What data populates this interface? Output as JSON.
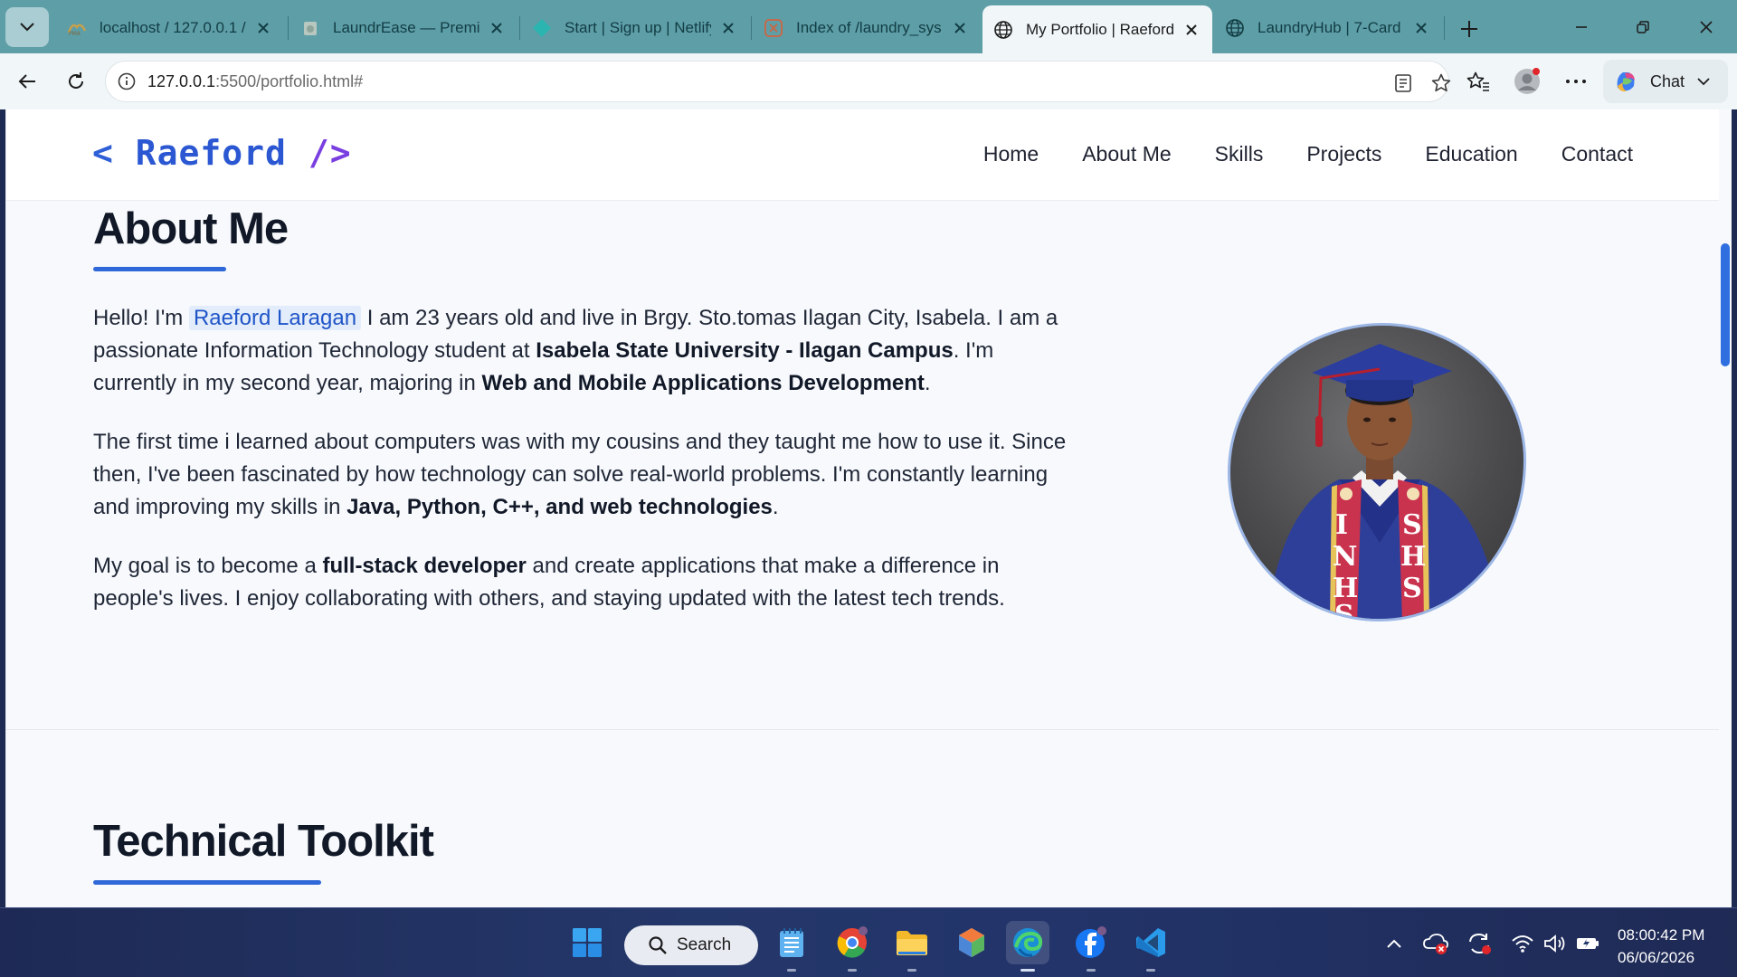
{
  "browser": {
    "tabs": [
      {
        "title": "localhost / 127.0.0.1 / ",
        "favicon": "phpmyadmin-icon"
      },
      {
        "title": "LaundrEase — Premium",
        "favicon": "laundry-icon"
      },
      {
        "title": "Start | Sign up | Netlify",
        "favicon": "netlify-icon"
      },
      {
        "title": "Index of /laundry_sys",
        "favicon": "xampp-icon"
      },
      {
        "title": "My Portfolio | Raeford",
        "favicon": "globe-icon",
        "active": true
      },
      {
        "title": "LaundryHub | 7-Card",
        "favicon": "globe-icon"
      }
    ],
    "url_host": "127.0.0.1",
    "url_path": ":5500/portfolio.html#",
    "chat_label": "Chat"
  },
  "site": {
    "logo_open": "<",
    "logo_name": "Raeford",
    "logo_close": "/>",
    "nav": [
      "Home",
      "About Me",
      "Skills",
      "Projects",
      "Education",
      "Contact"
    ]
  },
  "about": {
    "title": "About Me",
    "p1": {
      "t1": "Hello! I'm ",
      "name": "Raeford Laragan",
      "t2": " I am 23 years old and live in Brgy. Sto.tomas Ilagan City, Isabela. I am a passionate Information Technology student at ",
      "b1": "Isabela State University - Ilagan Campus",
      "t3": ". I'm currently in my second year, majoring in ",
      "b2": "Web and Mobile Applications Development",
      "t4": "."
    },
    "p2": {
      "t1": "The first time i learned about computers was with my cousins and they taught me how to use it. Since then, I've been fascinated by how technology can solve real-world problems. I'm constantly learning and improving my skills in ",
      "b1": "Java, Python, C++, and web technologies",
      "t2": "."
    },
    "p3": {
      "t1": "My goal is to become a ",
      "b1": "full-stack developer",
      "t2": " and create applications that make a difference in people's lives. I enjoy collaborating with others, and staying updated with the latest tech trends."
    },
    "sash_left": "INHS",
    "sash_right": "SHS"
  },
  "toolkit": {
    "title": "Technical Toolkit"
  },
  "taskbar": {
    "search_label": "Search",
    "time": "08:00:42 PM",
    "date": "06/06/2026"
  },
  "colors": {
    "tabbar": "#5e9ea7",
    "accent": "#2f68d8",
    "logo_purple": "#7a3fe0",
    "page_bg": "#f7f9fc"
  }
}
